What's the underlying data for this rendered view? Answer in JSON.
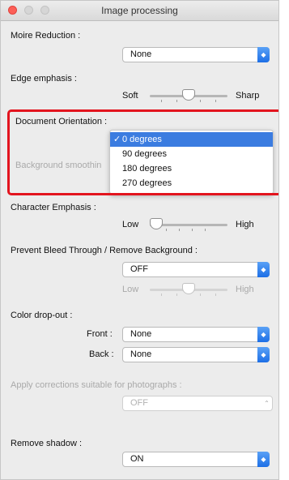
{
  "window": {
    "title": "Image processing"
  },
  "moire": {
    "label": "Moire Reduction :",
    "value": "None"
  },
  "edge": {
    "label": "Edge emphasis :",
    "left_label": "Soft",
    "right_label": "Sharp",
    "level": 0.5
  },
  "orientation": {
    "label": "Document Orientation :",
    "options": [
      {
        "label": "0 degrees",
        "selected": true
      },
      {
        "label": "90 degrees",
        "selected": false
      },
      {
        "label": "180 degrees",
        "selected": false
      },
      {
        "label": "270 degrees",
        "selected": false
      }
    ],
    "check": "✓"
  },
  "background_smoothing": {
    "label": "Background smoothin"
  },
  "character_emphasis": {
    "label": "Character Emphasis :",
    "left_label": "Low",
    "right_label": "High",
    "level": 0.0
  },
  "bleed": {
    "label": "Prevent Bleed Through / Remove Background :",
    "value": "OFF",
    "left_label": "Low",
    "right_label": "High",
    "level": 0.5
  },
  "color_dropout": {
    "label": "Color drop-out :",
    "front_label": "Front :",
    "front_value": "None",
    "back_label": "Back :",
    "back_value": "None"
  },
  "photo_corrections": {
    "label": "Apply corrections suitable for photographs :",
    "value": "OFF"
  },
  "remove_shadow": {
    "label": "Remove shadow :",
    "value": "ON"
  },
  "colors": {
    "accent": "#1d6fe6",
    "highlight": "#e3141e",
    "selection": "#3b7ce0"
  },
  "icons": {
    "select_arrow": "updown-chevron-icon"
  }
}
